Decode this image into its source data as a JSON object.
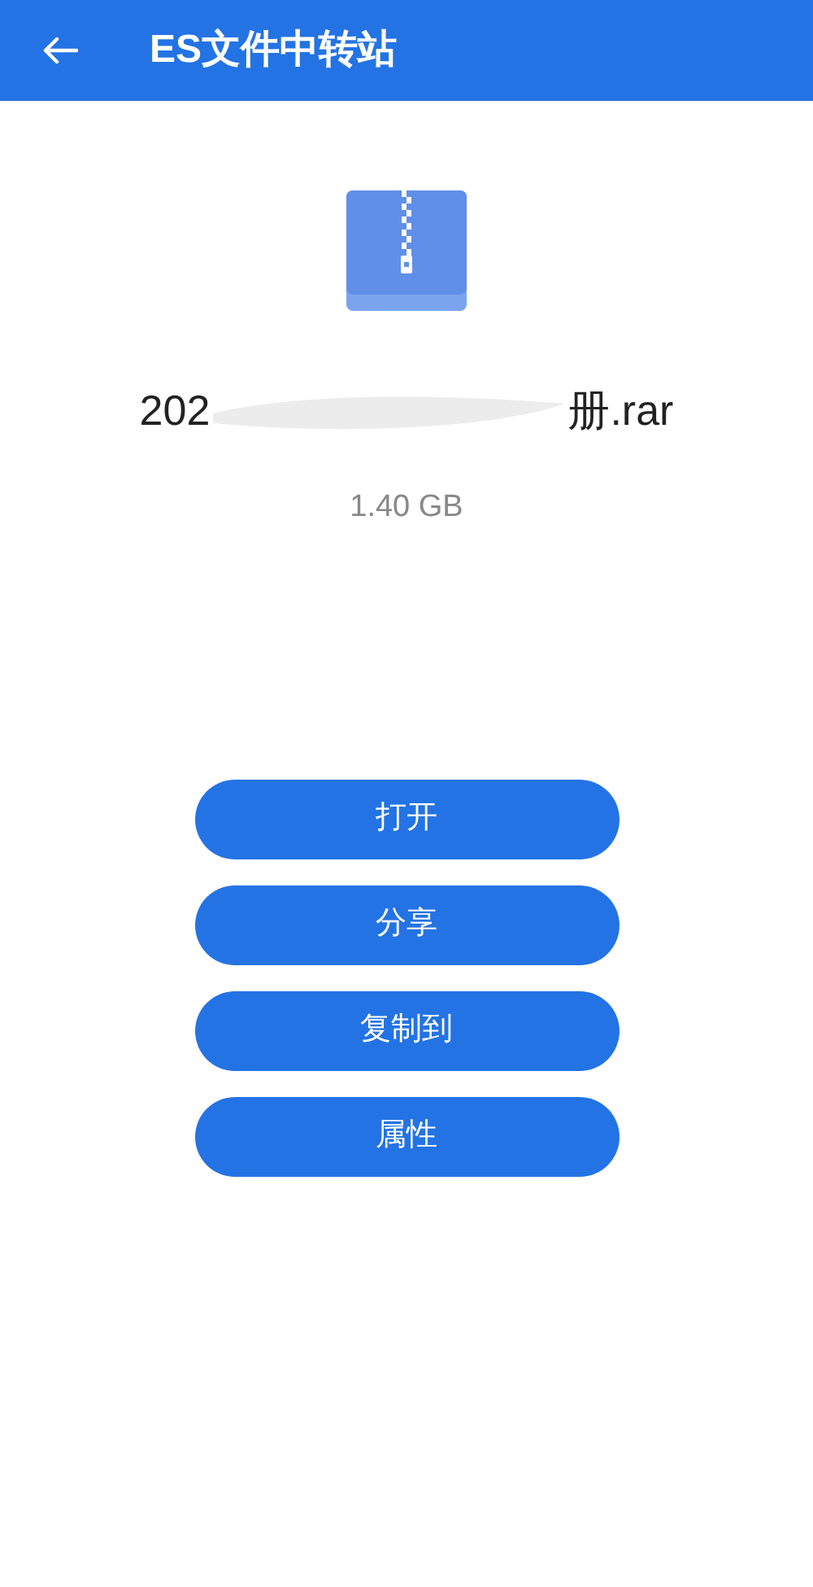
{
  "app_bar": {
    "title": "ES文件中转站"
  },
  "file": {
    "name_start": "202",
    "name_end": "册.rar",
    "redacted": true,
    "size": "1.40 GB"
  },
  "buttons": [
    "打开",
    "分享",
    "复制到",
    "属性"
  ]
}
